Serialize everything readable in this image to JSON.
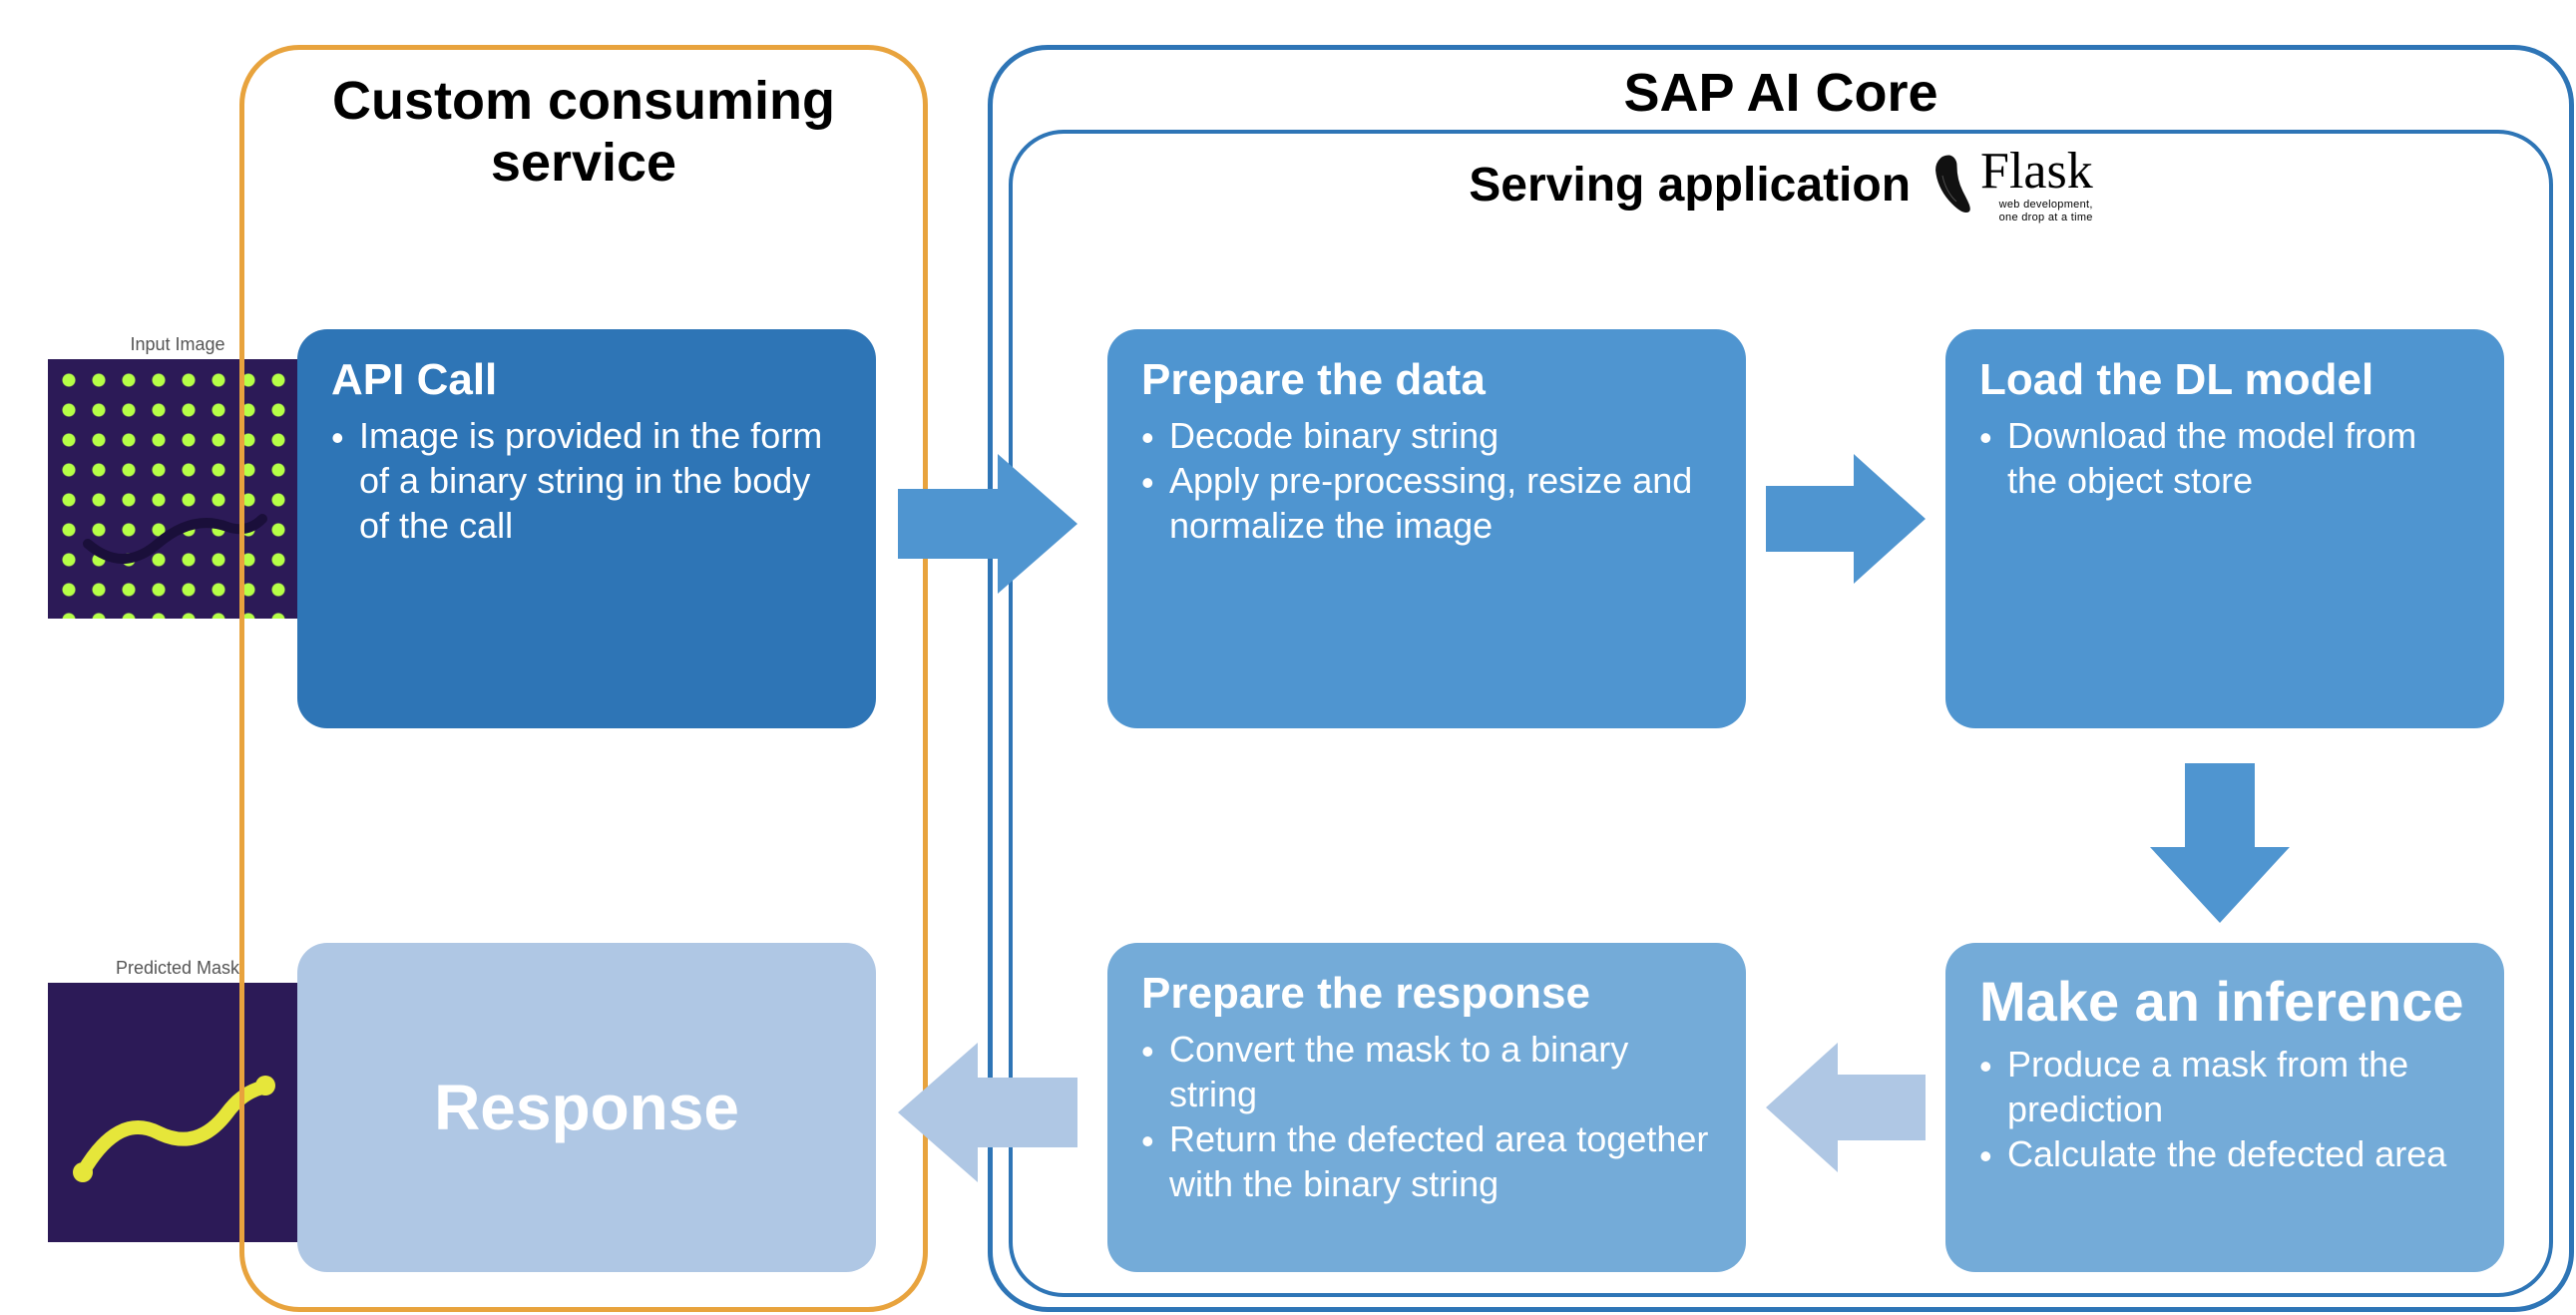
{
  "left_panel": {
    "title": "Custom consuming service"
  },
  "right_panel": {
    "title": "SAP AI Core"
  },
  "serving": {
    "title": "Serving application",
    "flask_word": "Flask",
    "flask_sub1": "web development,",
    "flask_sub2": "one drop at a time"
  },
  "thumbnails": {
    "input_label": "Input Image",
    "mask_label": "Predicted Mask"
  },
  "cards": {
    "api_call": {
      "title": "API Call",
      "bullets": [
        "Image is provided in the form of a binary string in the body of the call"
      ]
    },
    "prepare_data": {
      "title": "Prepare the data",
      "bullets": [
        "Decode binary string",
        "Apply pre-processing, resize and normalize the image"
      ]
    },
    "load_model": {
      "title": "Load the DL model",
      "bullets": [
        "Download the model from the object store"
      ]
    },
    "inference": {
      "title": "Make an inference",
      "bullets": [
        "Produce a mask from the prediction",
        "Calculate the defected area"
      ]
    },
    "prepare_response": {
      "title": "Prepare the response",
      "bullets": [
        "Convert the mask to a binary string",
        "Return the defected area together with the binary string"
      ]
    },
    "response": {
      "title": "Response"
    }
  },
  "arrow_colors": {
    "dark": "#4f95d0",
    "light": "#afc7e4"
  }
}
